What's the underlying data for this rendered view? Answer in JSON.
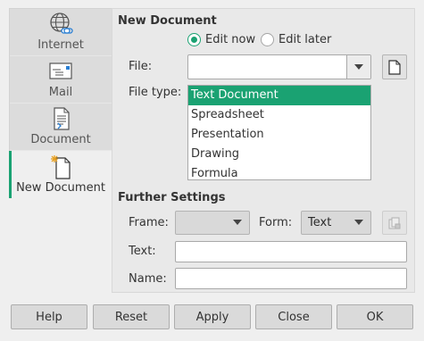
{
  "sidebar": {
    "items": [
      {
        "label": "Internet",
        "icon": "globe-icon"
      },
      {
        "label": "Mail",
        "icon": "envelope-icon"
      },
      {
        "label": "Document",
        "icon": "document-icon"
      },
      {
        "label": "New Document",
        "icon": "new-document-icon",
        "active": true
      }
    ]
  },
  "new_document": {
    "title": "New Document",
    "radio_edit_now": "Edit now",
    "radio_edit_later": "Edit later",
    "selected_mode": "Edit now",
    "file_label": "File:",
    "file_value": "",
    "file_type_label": "File type:",
    "file_types": [
      "Text Document",
      "Spreadsheet",
      "Presentation",
      "Drawing",
      "Formula"
    ],
    "selected_file_type": "Text Document"
  },
  "further_settings": {
    "title": "Further Settings",
    "frame_label": "Frame:",
    "frame_value": "",
    "form_label": "Form:",
    "form_value": "Text",
    "text_label": "Text:",
    "text_value": "",
    "name_label": "Name:",
    "name_value": ""
  },
  "buttons": {
    "help": "Help",
    "reset": "Reset",
    "apply": "Apply",
    "close": "Close",
    "ok": "OK"
  },
  "colors": {
    "accent": "#1aa272",
    "background": "#efefef"
  }
}
